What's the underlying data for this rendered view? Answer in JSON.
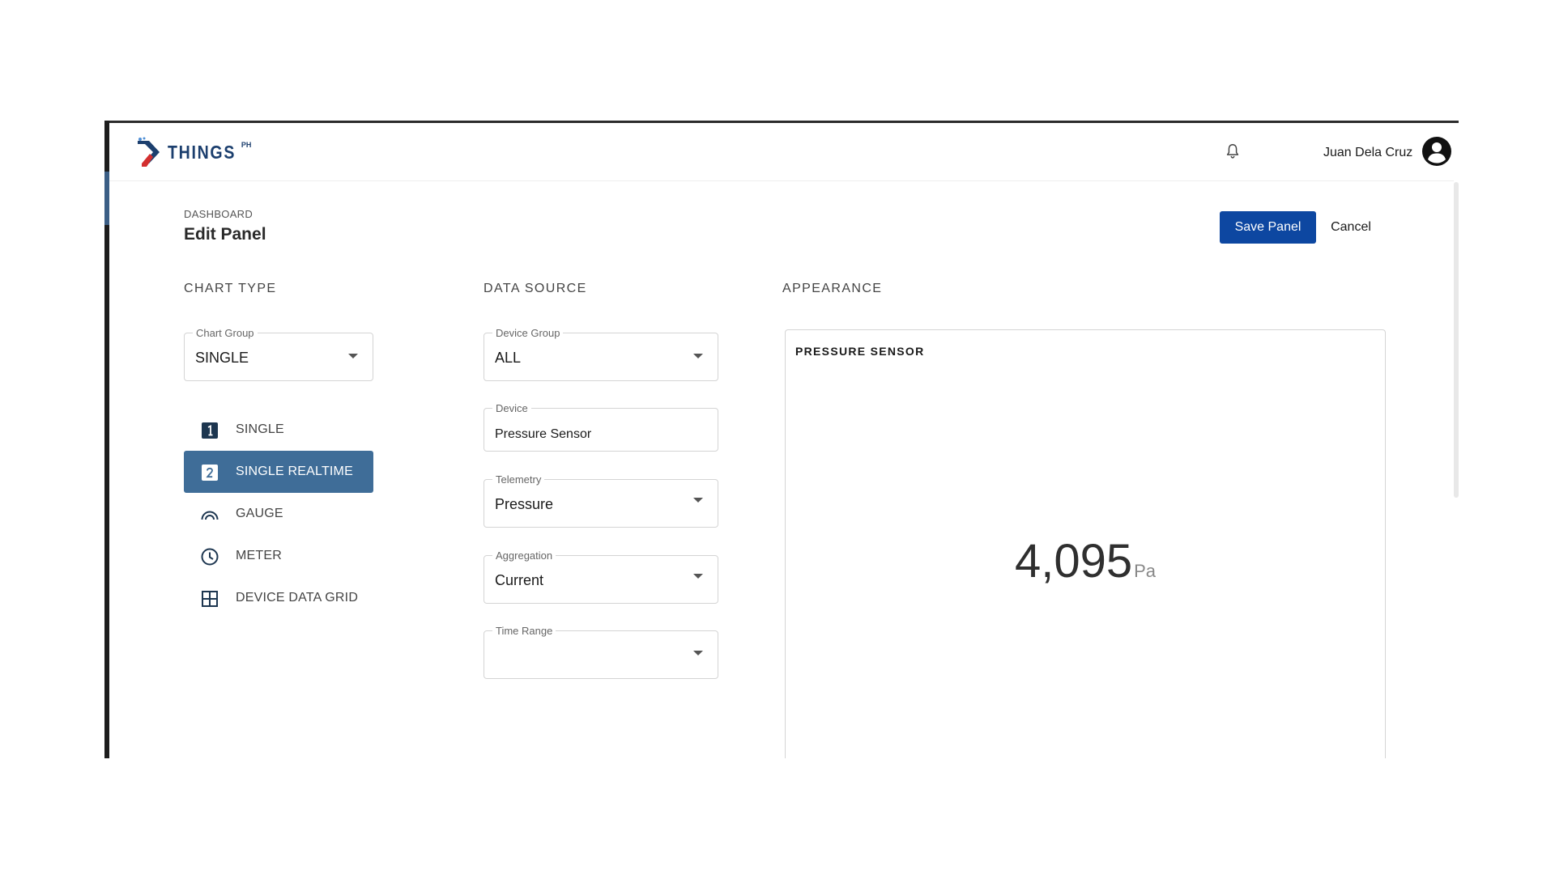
{
  "app": {
    "logo_text": "THINGS",
    "logo_superscript": "PH",
    "user_name": "Juan Dela Cruz",
    "icons": {
      "notifications": "bell-icon",
      "account": "account-circle-icon"
    }
  },
  "page": {
    "breadcrumb": "DASHBOARD",
    "title": "Edit Panel",
    "save_label": "Save Panel",
    "cancel_label": "Cancel"
  },
  "chart_type": {
    "section_title": "CHART TYPE",
    "chart_group": {
      "label": "Chart Group",
      "value": "SINGLE"
    },
    "options": [
      {
        "label": "SINGLE",
        "icon": "looks-one-icon",
        "active": false
      },
      {
        "label": "SINGLE REALTIME",
        "icon": "looks-two-icon",
        "active": true
      },
      {
        "label": "GAUGE",
        "icon": "gauge-icon",
        "active": false
      },
      {
        "label": "METER",
        "icon": "clock-icon",
        "active": false
      },
      {
        "label": "DEVICE DATA GRID",
        "icon": "grid-icon",
        "active": false
      }
    ]
  },
  "data_source": {
    "section_title": "DATA SOURCE",
    "device_group": {
      "label": "Device Group",
      "value": "ALL"
    },
    "device": {
      "label": "Device",
      "value": "Pressure Sensor"
    },
    "telemetry": {
      "label": "Telemetry",
      "value": "Pressure"
    },
    "aggregation": {
      "label": "Aggregation",
      "value": "Current"
    },
    "time_range": {
      "label": "Time Range",
      "value": ""
    }
  },
  "appearance": {
    "section_title": "APPEARANCE",
    "panel_title": "PRESSURE SENSOR",
    "value": "4,095",
    "unit": "Pa"
  },
  "colors": {
    "primary_button": "#0d47a1",
    "active_item": "#3f6d98",
    "logo": "#1c3f6e",
    "logo_accent": "#d32f2f"
  }
}
